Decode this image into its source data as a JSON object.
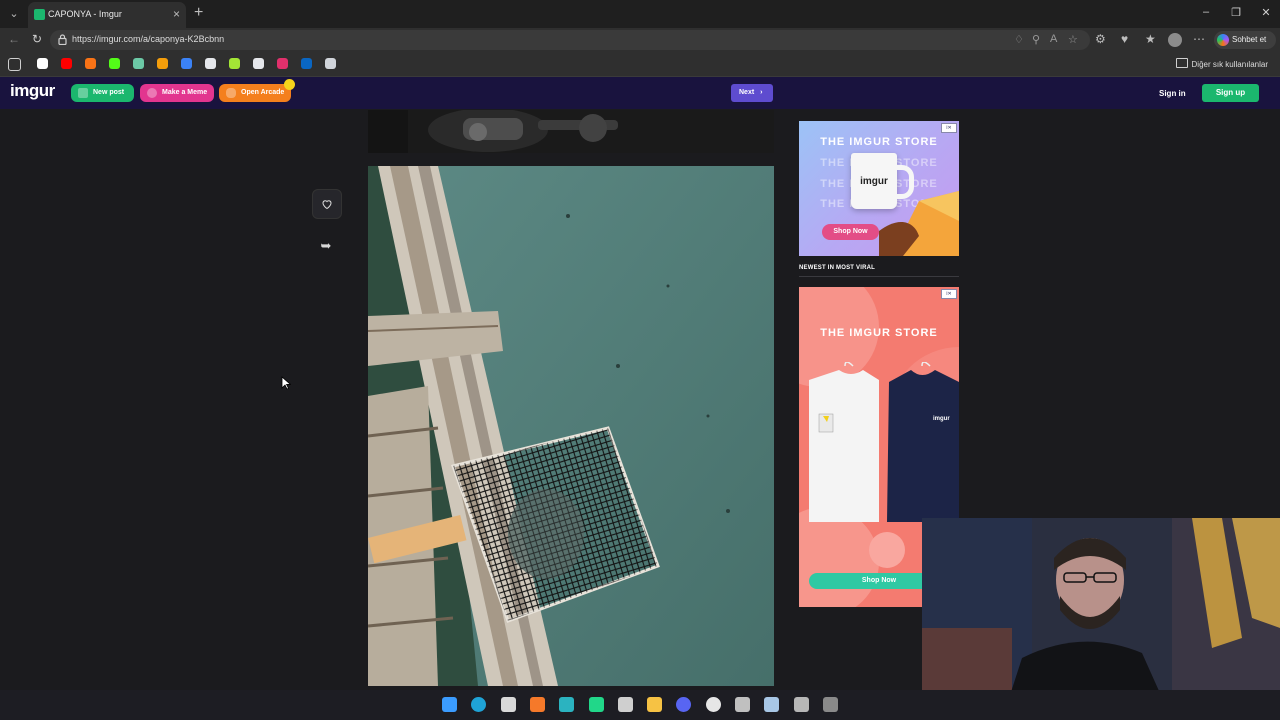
{
  "browser": {
    "tab_title": "CAPONYA - Imgur",
    "url": "https://imgur.com/a/caponya-K2Bcbnn",
    "copilot_label": "Sohbet et",
    "bookmarks_folder_label": "Diğer sık kullanılanlar",
    "bookmark_icons": [
      {
        "name": "google",
        "color": "#ffffff"
      },
      {
        "name": "youtube",
        "color": "#ff0000"
      },
      {
        "name": "star",
        "color": "#f97316"
      },
      {
        "name": "kick",
        "color": "#53fc18"
      },
      {
        "name": "maps",
        "color": "#6cc9a6"
      },
      {
        "name": "circle",
        "color": "#f59e0b"
      },
      {
        "name": "triangle",
        "color": "#3b82f6"
      },
      {
        "name": "copyright",
        "color": "#e5e7eb"
      },
      {
        "name": "grid",
        "color": "#a3e635"
      },
      {
        "name": "notion",
        "color": "#e5e7eb"
      },
      {
        "name": "instagram",
        "color": "#e1306c"
      },
      {
        "name": "linkedin",
        "color": "#0a66c2"
      },
      {
        "name": "chatgpt",
        "color": "#d1d5db"
      }
    ]
  },
  "header": {
    "logo": "imgur",
    "new_post": "New post",
    "make_meme": "Make a Meme",
    "open_arcade": "Open Arcade",
    "next": "Next",
    "sign_in": "Sign in",
    "sign_up": "Sign up"
  },
  "sidebar_ads": {
    "ad1_title": "THE IMGUR STORE",
    "ad1_mug_text": "imgur",
    "ad1_shop": "Shop Now",
    "section_label": "NEWEST IN MOST VIRAL",
    "ad2_title": "THE IMGUR STORE",
    "ad2_shirt_text": "imgur",
    "ad2_shop": "Shop Now"
  },
  "taskbar_icons": [
    {
      "name": "windows",
      "color": "#3b9cff"
    },
    {
      "name": "edge",
      "color": "#1fa3d6"
    },
    {
      "name": "app-a",
      "color": "#d9d9d9"
    },
    {
      "name": "blender",
      "color": "#f5792a"
    },
    {
      "name": "app-m",
      "color": "#2bb3c0"
    },
    {
      "name": "pycharm",
      "color": "#21d789"
    },
    {
      "name": "app-q",
      "color": "#cfcfcf"
    },
    {
      "name": "file-explorer",
      "color": "#f6c244"
    },
    {
      "name": "discord",
      "color": "#5865f2"
    },
    {
      "name": "obs",
      "color": "#e6e6e6"
    },
    {
      "name": "app-clock",
      "color": "#c0c0c0"
    },
    {
      "name": "steam",
      "color": "#a8c7e6"
    },
    {
      "name": "app-game",
      "color": "#b7b7b7"
    },
    {
      "name": "app-muza",
      "color": "#8a8a8a"
    }
  ]
}
